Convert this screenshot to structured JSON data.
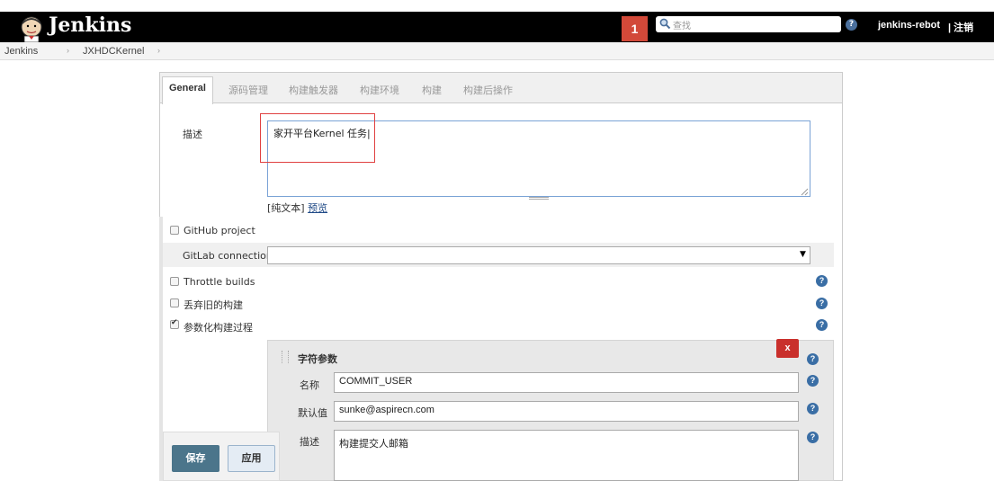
{
  "header": {
    "title": "Jenkins",
    "notification_count": "1",
    "search_placeholder": "查找",
    "username": "jenkins-rebot",
    "logout_label": "| 注销"
  },
  "breadcrumb": {
    "items": [
      "Jenkins",
      "JXHDCKernel"
    ]
  },
  "tabs": [
    {
      "label": "General",
      "active": true
    },
    {
      "label": "源码管理",
      "active": false
    },
    {
      "label": "构建触发器",
      "active": false
    },
    {
      "label": "构建环境",
      "active": false
    },
    {
      "label": "构建",
      "active": false
    },
    {
      "label": "构建后操作",
      "active": false
    }
  ],
  "general": {
    "description_label": "描述",
    "description_value": "家开平台Kernel 任务|",
    "plain_text_label": "[纯文本]",
    "preview_label": "预览",
    "github_project_label": "GitHub project",
    "gitlab_connection_label": "GitLab connection",
    "gitlab_connection_value": "",
    "throttle_builds_label": "Throttle builds",
    "discard_old_label": "丢弃旧的构建",
    "parameterized_label": "参数化构建过程",
    "parameterized_checked": true
  },
  "string_param": {
    "title": "字符参数",
    "delete_label": "x",
    "name_label": "名称",
    "name_value": "COMMIT_USER",
    "default_label": "默认值",
    "default_value": "sunke@aspirecn.com",
    "description_label": "描述",
    "description_value": "构建提交人邮箱"
  },
  "actions": {
    "save_label": "保存",
    "apply_label": "应用"
  },
  "colors": {
    "header_bg": "#000000",
    "notif_red": "#d24939",
    "delete_red": "#c9302c",
    "save_blue": "#4b758b",
    "help_blue": "#3a6ea5"
  }
}
